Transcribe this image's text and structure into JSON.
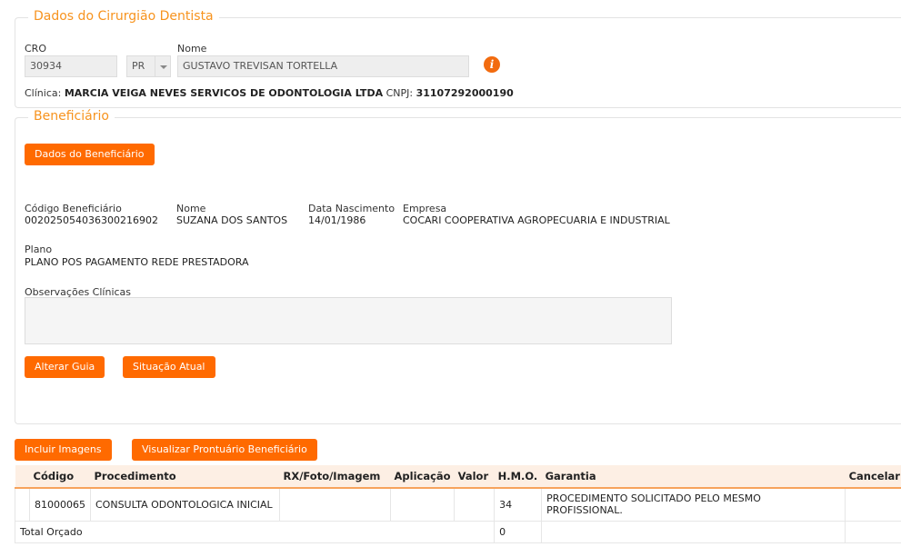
{
  "cirurgiao": {
    "legend": "Dados do Cirurgião Dentista",
    "cro_label": "CRO",
    "cro_value": "30934",
    "uf_value": "PR",
    "nome_label": "Nome",
    "nome_value": "GUSTAVO TREVISAN TORTELLA",
    "info_glyph": "i",
    "clinica_label": "Clínica:",
    "clinica_value": "MARCIA VEIGA NEVES SERVICOS DE ODONTOLOGIA LTDA",
    "cnpj_label": "CNPJ:",
    "cnpj_value": "31107292000190"
  },
  "beneficiario": {
    "legend": "Beneficiário",
    "dados_button": "Dados do Beneficiário",
    "codigo_label": "Código Beneficiário",
    "codigo_value": "00202505403630021​6902",
    "nome_label": "Nome",
    "nome_value": "SUZANA DOS SANTOS",
    "nasc_label": "Data Nascimento",
    "nasc_value": "14/01/1986",
    "empresa_label": "Empresa",
    "empresa_value": "COCARI COOPERATIVA AGROPECUARIA E INDUSTRIAL",
    "plano_label": "Plano",
    "plano_value": "PLANO POS PAGAMENTO REDE PRESTADORA",
    "obs_label": "Observações Clínicas",
    "alterar_button": "Alterar Guia",
    "situacao_button": "Situação Atual"
  },
  "actions": {
    "incluir_imagens": "Incluir Imagens",
    "visualizar_prontuario": "Visualizar Prontuário Beneficiário"
  },
  "table": {
    "headers": {
      "codigo": "Código",
      "procedimento": "Procedimento",
      "rx": "RX/Foto/Imagem",
      "aplicacao": "Aplicação",
      "valor": "Valor",
      "hmo": "H.M.O.",
      "garantia": "Garantia",
      "cancelar": "Cancelar"
    },
    "rows": [
      {
        "codigo": "81000065",
        "procedimento": "CONSULTA ODONTOLOGICA INICIAL",
        "rx": "",
        "aplicacao": "",
        "valor": "",
        "hmo": "34",
        "garantia": "PROCEDIMENTO SOLICITADO PELO MESMO PROFISSIONAL.",
        "cancelar": ""
      }
    ],
    "total_label": "Total Orçado",
    "total_hmo": "0"
  }
}
